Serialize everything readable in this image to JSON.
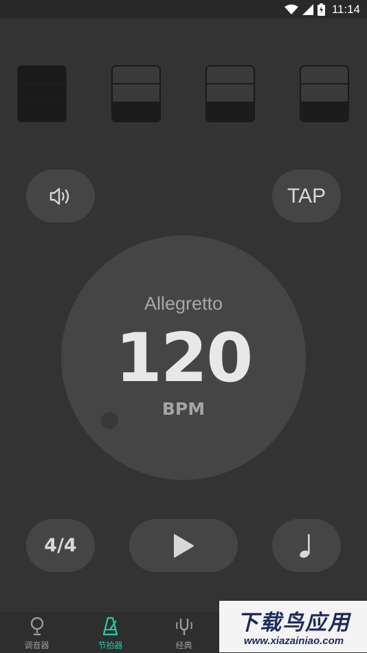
{
  "status_bar": {
    "time": "11:14",
    "icons": [
      "wifi-icon",
      "cell-signal-icon",
      "battery-charging-icon"
    ]
  },
  "beats": [
    {
      "type": "accent-full"
    },
    {
      "type": "normal"
    },
    {
      "type": "normal"
    },
    {
      "type": "normal"
    }
  ],
  "controls": {
    "sound_icon": "speaker-icon",
    "tap_label": "TAP",
    "time_signature": "4/4",
    "play_icon": "play-icon",
    "note_icon": "quarter-note-icon"
  },
  "tempo": {
    "name": "Allegretto",
    "bpm": "120",
    "unit": "BPM"
  },
  "bottom_nav": {
    "active_index": 1,
    "active_color": "#26c6a6",
    "items": [
      {
        "label": "调音器",
        "icon": "tuner-icon"
      },
      {
        "label": "节拍器",
        "icon": "metronome-icon"
      },
      {
        "label": "经典",
        "icon": "tuning-fork-icon"
      }
    ]
  },
  "watermark": {
    "title": "下载鸟应用",
    "url": "www.xiazainiao.com"
  }
}
